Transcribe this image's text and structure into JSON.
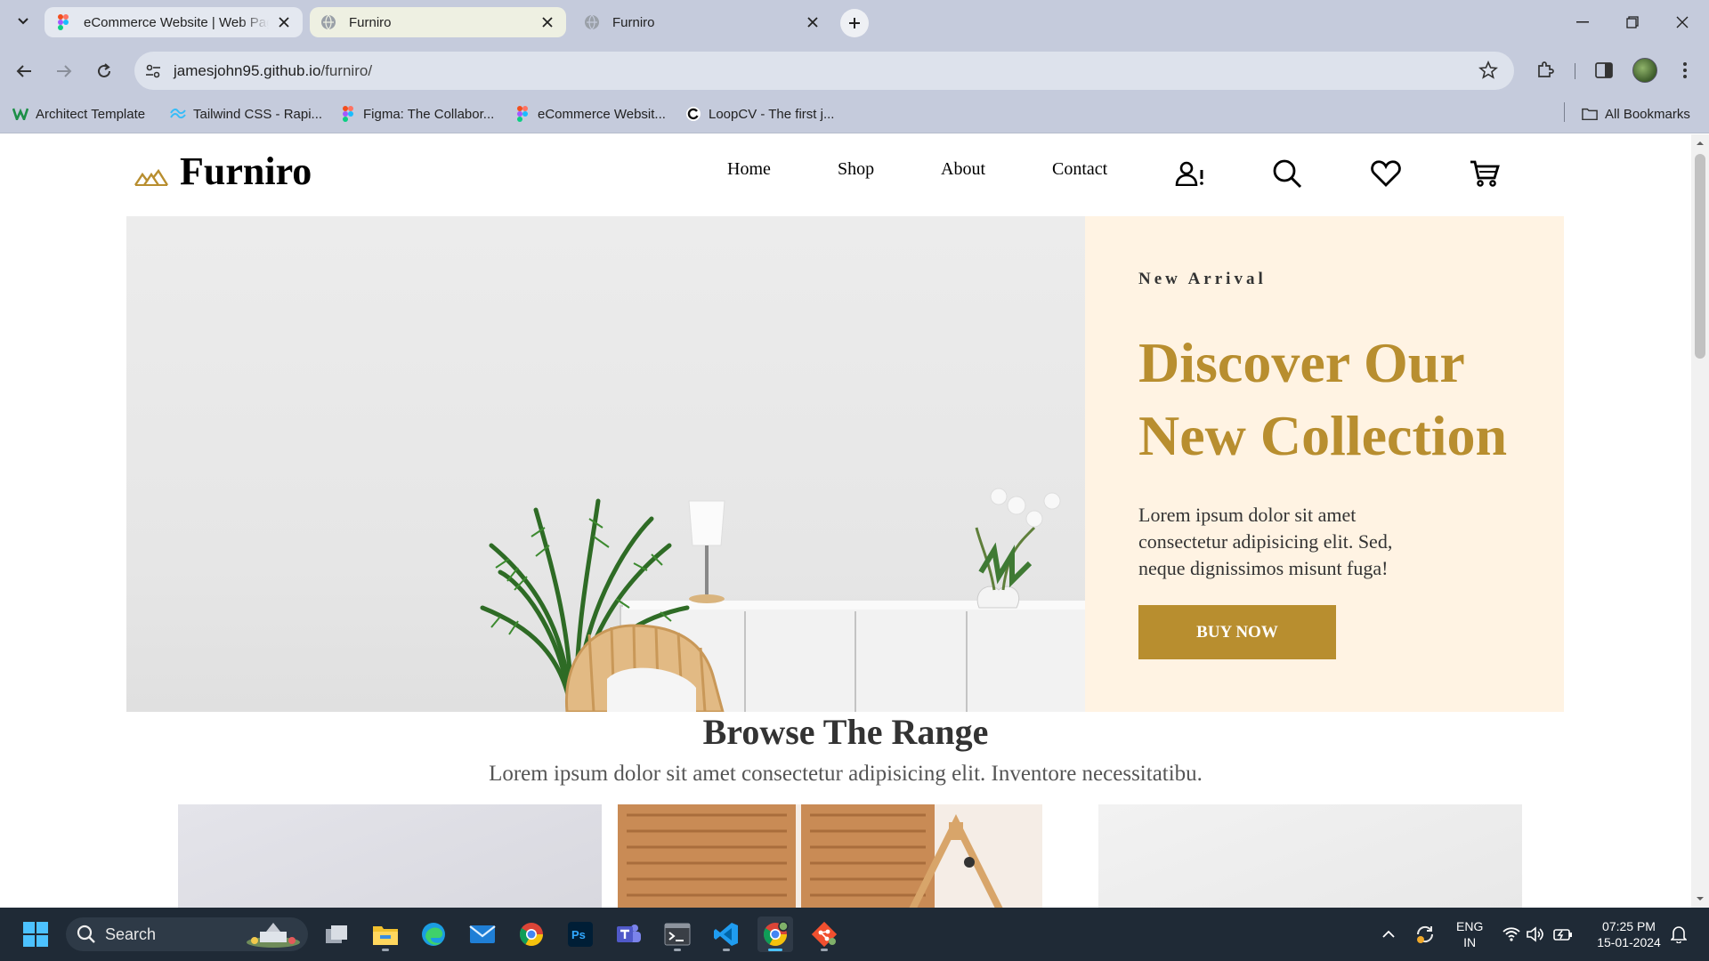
{
  "browser": {
    "tabs": [
      {
        "title": "eCommerce Website | Web Pag",
        "favicon": "figma-icon"
      },
      {
        "title": "Furniro",
        "favicon": "globe-icon"
      },
      {
        "title": "Furniro",
        "favicon": "globe-icon"
      }
    ],
    "active_tab_index": 1,
    "url_domain": "jamesjohn95.github.io",
    "url_path": "/furniro/",
    "bookmarks": [
      {
        "label": "Architect Template",
        "icon": "w-logo-icon"
      },
      {
        "label": "Tailwind CSS - Rapi...",
        "icon": "tailwind-icon"
      },
      {
        "label": "Figma: The Collabor...",
        "icon": "figma-icon"
      },
      {
        "label": "eCommerce Websit...",
        "icon": "figma-icon"
      },
      {
        "label": "LoopCV - The first j...",
        "icon": "loopcv-icon"
      }
    ],
    "all_bookmarks_label": "All Bookmarks"
  },
  "site": {
    "logo_text": "Furniro",
    "nav": [
      "Home",
      "Shop",
      "About",
      "Contact"
    ],
    "header_icons": [
      "account-alert-icon",
      "search-icon",
      "heart-icon",
      "cart-icon"
    ],
    "hero": {
      "eyebrow": "New Arrival",
      "title_line1": "Discover Our",
      "title_line2": "New Collection",
      "text": "Lorem ipsum dolor sit amet consectetur adipisicing elit. Sed, neque dignissimos misunt fuga!",
      "button": "BUY NOW"
    },
    "range": {
      "title": "Browse The Range",
      "subtitle": "Lorem ipsum dolor sit amet consectetur adipisicing elit. Inventore necessitatibu."
    }
  },
  "taskbar": {
    "search_label": "Search",
    "apps": [
      "task-view-icon",
      "file-explorer-icon",
      "edge-icon",
      "mail-icon",
      "chrome-icon",
      "photoshop-icon",
      "teams-icon",
      "terminal-icon",
      "vscode-icon",
      "chrome-dev-icon",
      "git-icon"
    ],
    "lang_line1": "ENG",
    "lang_line2": "IN",
    "time": "07:25 PM",
    "date": "15-01-2024"
  },
  "colors": {
    "accent": "#b88e2f",
    "hero_panel_bg": "#fff3e3",
    "chrome_bg": "#c5cbdc",
    "taskbar_bg": "#1f2a36"
  }
}
